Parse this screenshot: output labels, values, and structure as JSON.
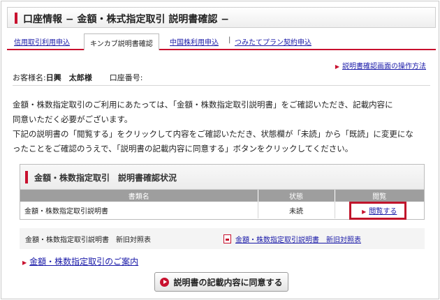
{
  "title": "口座情報 − 金額・株式指定取引 説明書確認 −",
  "tabs": [
    {
      "label": "信用取引利用申込",
      "active": false
    },
    {
      "label": "キンカブ説明書確認",
      "active": true
    },
    {
      "label": "中国株利用申込",
      "active": false
    },
    {
      "label": "つみたてプラン契約申込",
      "active": false
    }
  ],
  "tab_separator": "|",
  "help_link": "説明書確認画面の操作方法",
  "customer": {
    "name_label": "お客様名:",
    "name": "日興　太郎",
    "honorific": "様",
    "account_label": "口座番号:"
  },
  "intro": {
    "line1": "金額・株数指定取引のご利用にあたっては、「金額・株数指定取引説明書」をご確認いただき、記載内容に",
    "line2": "同意いただく必要がございます。",
    "line3": "下記の説明書の「閲覧する」をクリックして内容をご確認いただき、状態欄が「未読」から「既読」に変更にな",
    "line4": "ったことをご確認のうえで、「説明書の記載内容に同意する」ボタンをクリックしてください。"
  },
  "panel": {
    "title": "金額・株数指定取引　説明書確認状況",
    "columns": {
      "name": "書類名",
      "status": "状態",
      "view": "閲覧"
    },
    "rows": [
      {
        "name": "金額・株数指定取引説明書",
        "status": "未読",
        "view_link": "閲覧する"
      }
    ]
  },
  "compare": {
    "label": "金額・株数指定取引説明書　新旧対照表",
    "link": "金額・株数指定取引説明書　新旧対照表"
  },
  "guide_link": "金額・株数指定取引のご案内",
  "agree_button": "説明書の記載内容に同意する",
  "colors": {
    "accent": "#c8102e",
    "link": "#1a1aa8",
    "table_header": "#9e9e9e"
  }
}
